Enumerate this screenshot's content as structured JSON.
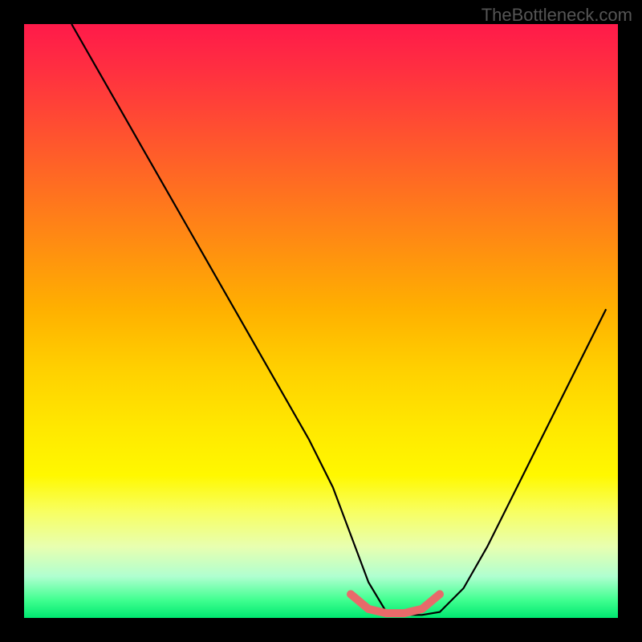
{
  "watermark": "TheBottleneck.com",
  "chart_data": {
    "type": "line",
    "title": "",
    "xlabel": "",
    "ylabel": "",
    "xlim": [
      0,
      100
    ],
    "ylim": [
      0,
      100
    ],
    "series": [
      {
        "name": "bottleneck-curve",
        "x": [
          8,
          12,
          16,
          20,
          24,
          28,
          32,
          36,
          40,
          44,
          48,
          52,
          55,
          58,
          61,
          64,
          67,
          70,
          74,
          78,
          82,
          86,
          90,
          94,
          98
        ],
        "y": [
          100,
          93,
          86,
          79,
          72,
          65,
          58,
          51,
          44,
          37,
          30,
          22,
          14,
          6,
          1,
          0.5,
          0.5,
          1,
          5,
          12,
          20,
          28,
          36,
          44,
          52
        ]
      }
    ],
    "highlight": {
      "name": "optimal-zone",
      "color": "#e86a6a",
      "x": [
        55,
        58,
        61,
        64,
        67,
        70
      ],
      "y": [
        4,
        1.5,
        0.8,
        0.8,
        1.5,
        4
      ]
    },
    "gradient_stops": [
      {
        "pos": 0,
        "color": "#ff1a4a"
      },
      {
        "pos": 50,
        "color": "#ffd000"
      },
      {
        "pos": 90,
        "color": "#f0ffb0"
      },
      {
        "pos": 100,
        "color": "#00e870"
      }
    ]
  }
}
